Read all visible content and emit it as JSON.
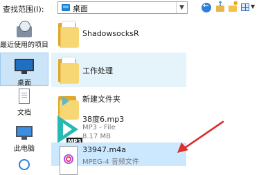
{
  "lookin": {
    "label": "查找范围(I):",
    "location": "桌面"
  },
  "toolbar": {
    "back_icon": "back-arrow-icon",
    "up_icon": "up-folder-icon",
    "new_folder_icon": "new-folder-icon",
    "view_icon": "view-menu-icon"
  },
  "places": {
    "recent": "最近使用的项目",
    "desktop": "桌面",
    "documents": "文档",
    "this_pc": "此电脑"
  },
  "files": [
    {
      "name": "ShadowsocksR",
      "type": "folder"
    },
    {
      "name": "工作处理",
      "type": "folder"
    },
    {
      "name": "新建文件夹",
      "type": "folder"
    },
    {
      "name": "38度6.mp3",
      "line2": "MP3 - File",
      "line3": "8.17 MB",
      "badge": "MP3"
    },
    {
      "name": "33947.m4a",
      "line2": "MPEG-4 音频文件"
    }
  ],
  "colors": {
    "selection": "#cce8ff",
    "hover": "#e5f3fb",
    "annotation_arrow": "#d93030"
  }
}
